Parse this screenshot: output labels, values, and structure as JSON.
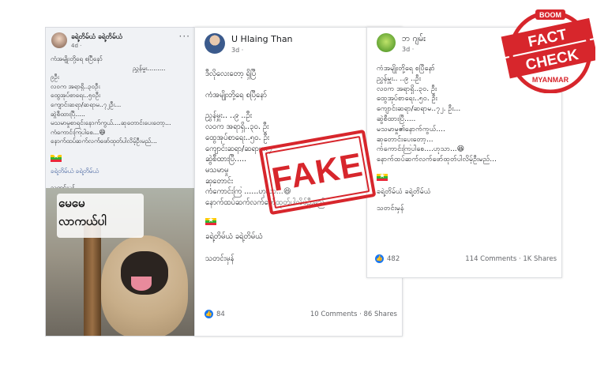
{
  "post_left": {
    "author": "ခရဲ့တိမ်ယံ ခရဲ့တိမ်ယံ",
    "time": "4d ·",
    "lines": [
      "ကံအမျိုးတို့ရေ စပြီနော်",
      "ညွှန်မှူး.........",
      "၉ဦး",
      "လဝက အရာရှိ..၃၀ဦး",
      "ထွေအုပ်စာရေး..၅၀ဦး",
      "ကျောင်းဆရာ/ဆရာမ..၇၂ဦး...",
      "ဆွဲစီထားပြီ.....",
      "မသမာမှုစာရင်းနောက်ကွယ်....ဆုတောင်းပေးတော့...",
      "ကံကောင်းကြပါစေ...😆",
      "နောက်ထပ်ဆက်လက်ဖော်ထုတ်ပါလိမ့်ဦးမည်..."
    ],
    "signature": "ခရဲ့တိမ်ယံ ခရဲ့တိမ်ယံ",
    "footer": "သတင်းမှန်",
    "meme_line1": "မေမေ",
    "meme_line2": "လာကယ်ပါ"
  },
  "post_mid": {
    "author": "U Hlaing Than",
    "time": "3d ·",
    "intro": "ဒီလိုလေးတော့ ရှိပြီ",
    "lines": [
      "ကံအမျိုးတို့ရေ စပြီနော်",
      "",
      "ညွှန်မှူး.. ..၉ ..ဦး",
      "လဝက အရာရှိ..၃၀. ဦး",
      "ထွေအုပ်စာရေး..၅၀. ဦး",
      "ကျောင်းဆရာ/ဆရာမ..၇",
      "ဆွဲစီထားပြီ.....",
      "မသမာမှု",
      "ဆုတောင်း",
      "ကံကောင်းကြ ......ဟုသာ...😆",
      "နောက်ထပ်ဆက်လက်ဖော်ထုတ်ပါလိမ့်ဦးမည်"
    ],
    "signature": "ခရဲ့တိမ်ယံ ခရဲ့တိမ်ယံ",
    "footer": "သတင်းမှန်",
    "likes": "84",
    "comments_shares": "10 Comments · 86 Shares"
  },
  "post_right": {
    "author": "ဘ ဂျမ်း",
    "time": "3d ·",
    "lines": [
      "ကံအမျိုးတို့ရေ စပြီနော်",
      "ညွှန်မှူး.. ..၉ ..ဦး",
      "လဝက အရာရှိ..၃၀. ဦး",
      "ထွေအုပ်စာရေး..၅၀. ဦး",
      "ကျောင်းဆရာ/ဆရာမ..၇၂. ဦး...",
      "ဆွဲစီထားပြီ.....",
      "မသမာမှု၏နောက်ကွယ်....",
      "ဆုတောင်းပေးတော့...",
      "ကံကောင်းကြပါစေ....ဟုသာ...😆",
      "နောက်ထပ်ဆက်လက်ဖော်ထုတ်ပါလိမ့်ဦးမည်..."
    ],
    "signature": "ခရဲ့တိမ်ယံ ခရဲ့တိမ်ယံ",
    "footer": "သတင်းမှန်",
    "likes": "482",
    "comments_shares": "114 Comments · 1K Shares"
  },
  "stamp": {
    "text": "FAKE",
    "color": "#d7262c"
  },
  "badge": {
    "top": "BOOM",
    "line1": "FACT",
    "line2": "CHECK",
    "bottom": "MYANMAR",
    "color": "#d7262c"
  },
  "colors": {
    "like_blue": "#1877f2",
    "stamp_red": "#d7262c"
  }
}
